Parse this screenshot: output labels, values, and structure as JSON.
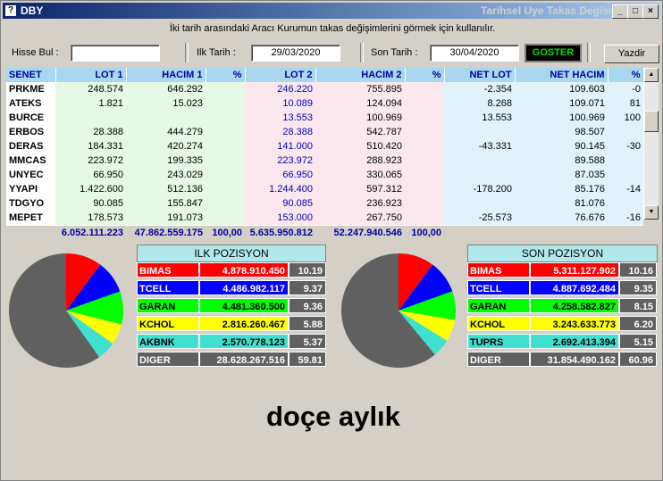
{
  "window": {
    "title": "DBY",
    "subtitle": "Tarihsel Uye Takas Degisim",
    "min": "_",
    "max": "□",
    "close": "×"
  },
  "info_text": "İki tarih arasındaki  Aracı Kurumun takas değişimlerini görmek için kullanılır.",
  "controls": {
    "hisse_label": "Hisse Bul :",
    "hisse_value": "",
    "ilk_label": "Ilk Tarih :",
    "ilk_value": "29/03/2020",
    "son_label": "Son Tarih :",
    "son_value": "30/04/2020",
    "goster": "GOSTER",
    "yazdir": "Yazdir"
  },
  "table": {
    "headers": [
      "SENET",
      "LOT 1",
      "HACIM 1",
      "%",
      "LOT 2",
      "HACIM 2",
      "%",
      "NET LOT",
      "NET HACIM",
      "%"
    ],
    "rows": [
      [
        "PRKME",
        "248.574",
        "646.292",
        "",
        "246.220",
        "755.895",
        "",
        "-2.354",
        "109.603",
        "-0"
      ],
      [
        "ATEKS",
        "1.821",
        "15.023",
        "",
        "10.089",
        "124.094",
        "",
        "8.268",
        "109.071",
        "81"
      ],
      [
        "BURCE",
        "",
        "",
        "",
        "13.553",
        "100.969",
        "",
        "13.553",
        "100.969",
        "100"
      ],
      [
        "ERBOS",
        "28.388",
        "444.279",
        "",
        "28.388",
        "542.787",
        "",
        "",
        "98.507",
        ""
      ],
      [
        "DERAS",
        "184.331",
        "420.274",
        "",
        "141.000",
        "510.420",
        "",
        "-43.331",
        "90.145",
        "-30"
      ],
      [
        "MMCAS",
        "223.972",
        "199.335",
        "",
        "223.972",
        "288.923",
        "",
        "",
        "89.588",
        ""
      ],
      [
        "UNYEC",
        "66.950",
        "243.029",
        "",
        "66.950",
        "330.065",
        "",
        "",
        "87.035",
        ""
      ],
      [
        "YYAPI",
        "1.422.600",
        "512.136",
        "",
        "1.244.400",
        "597.312",
        "",
        "-178.200",
        "85.176",
        "-14"
      ],
      [
        "TDGYO",
        "90.085",
        "155.847",
        "",
        "90.085",
        "236.923",
        "",
        "",
        "81.076",
        ""
      ],
      [
        "MEPET",
        "178.573",
        "191.073",
        "",
        "153.000",
        "267.750",
        "",
        "-25.573",
        "76.676",
        "-16"
      ]
    ],
    "totals": [
      "",
      "6.052.111.223",
      "47.862.559.175",
      "100,00",
      "5.635.950.812",
      "52.247.940.546",
      "100,00",
      "",
      "",
      ""
    ]
  },
  "ilk": {
    "title": "ILK POZISYON",
    "rows": [
      {
        "name": "BIMAS",
        "value": "4.878.910.450",
        "pct": "10.19",
        "pct_num": 10.19,
        "color": "#ff0000",
        "text": "#ffffff"
      },
      {
        "name": "TCELL",
        "value": "4.486.982.117",
        "pct": "9.37",
        "pct_num": 9.37,
        "color": "#0000ff",
        "text": "#ffffff"
      },
      {
        "name": "GARAN",
        "value": "4.481.360.500",
        "pct": "9.36",
        "pct_num": 9.36,
        "color": "#00ff00",
        "text": "#000000"
      },
      {
        "name": "KCHOL",
        "value": "2.816.260.467",
        "pct": "5.88",
        "pct_num": 5.88,
        "color": "#ffff00",
        "text": "#000000"
      },
      {
        "name": "AKBNK",
        "value": "2.570.778.123",
        "pct": "5.37",
        "pct_num": 5.37,
        "color": "#40e0d0",
        "text": "#000000"
      },
      {
        "name": "DIGER",
        "value": "28.628.267.516",
        "pct": "59.81",
        "pct_num": 59.81,
        "color": "#606060",
        "text": "#ffffff"
      }
    ]
  },
  "son": {
    "title": "SON POZISYON",
    "rows": [
      {
        "name": "BIMAS",
        "value": "5.311.127.902",
        "pct": "10.16",
        "pct_num": 10.16,
        "color": "#ff0000",
        "text": "#ffffff"
      },
      {
        "name": "TCELL",
        "value": "4.887.692.484",
        "pct": "9.35",
        "pct_num": 9.35,
        "color": "#0000ff",
        "text": "#ffffff"
      },
      {
        "name": "GARAN",
        "value": "4.258.582.827",
        "pct": "8.15",
        "pct_num": 8.15,
        "color": "#00ff00",
        "text": "#000000"
      },
      {
        "name": "KCHOL",
        "value": "3.243.633.773",
        "pct": "6.20",
        "pct_num": 6.2,
        "color": "#ffff00",
        "text": "#000000"
      },
      {
        "name": "TUPRS",
        "value": "2.692.413.394",
        "pct": "5.15",
        "pct_num": 5.15,
        "color": "#40e0d0",
        "text": "#000000"
      },
      {
        "name": "DIGER",
        "value": "31.854.490.162",
        "pct": "60.96",
        "pct_num": 60.96,
        "color": "#606060",
        "text": "#ffffff"
      }
    ]
  },
  "caption": "doçe aylık"
}
